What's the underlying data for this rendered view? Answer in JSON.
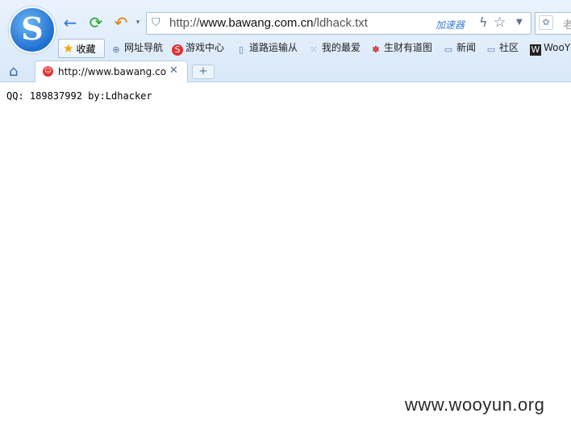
{
  "browser": {
    "url_prefix": "http://",
    "url_host": "www.bawang.com.cn",
    "url_path": "/ldhack.txt",
    "accelerator_label": "加速器",
    "search_hint": "老"
  },
  "bookmarks": {
    "favorites_label": "收藏",
    "items": [
      {
        "label": "网址导航",
        "icon": "globe-icon"
      },
      {
        "label": "游戏中心",
        "icon": "game-icon"
      },
      {
        "label": "道路运输从",
        "icon": "page-icon"
      },
      {
        "label": "我的最爱",
        "icon": "grid-icon"
      },
      {
        "label": "生财有道图",
        "icon": "paw-icon"
      },
      {
        "label": "新闻",
        "icon": "folder-icon"
      },
      {
        "label": "社区",
        "icon": "folder-icon"
      },
      {
        "label": "WooY",
        "icon": "wooyun-icon"
      }
    ]
  },
  "tab": {
    "title": "http://www.bawang.com.cn/ldhack.txt"
  },
  "page": {
    "text": "QQ: 189837992 by:Ldhacker"
  },
  "watermark": "www.wooyun.org",
  "colors": {
    "accent": "#3f7ad6",
    "chrome": "#dbe9f8"
  }
}
